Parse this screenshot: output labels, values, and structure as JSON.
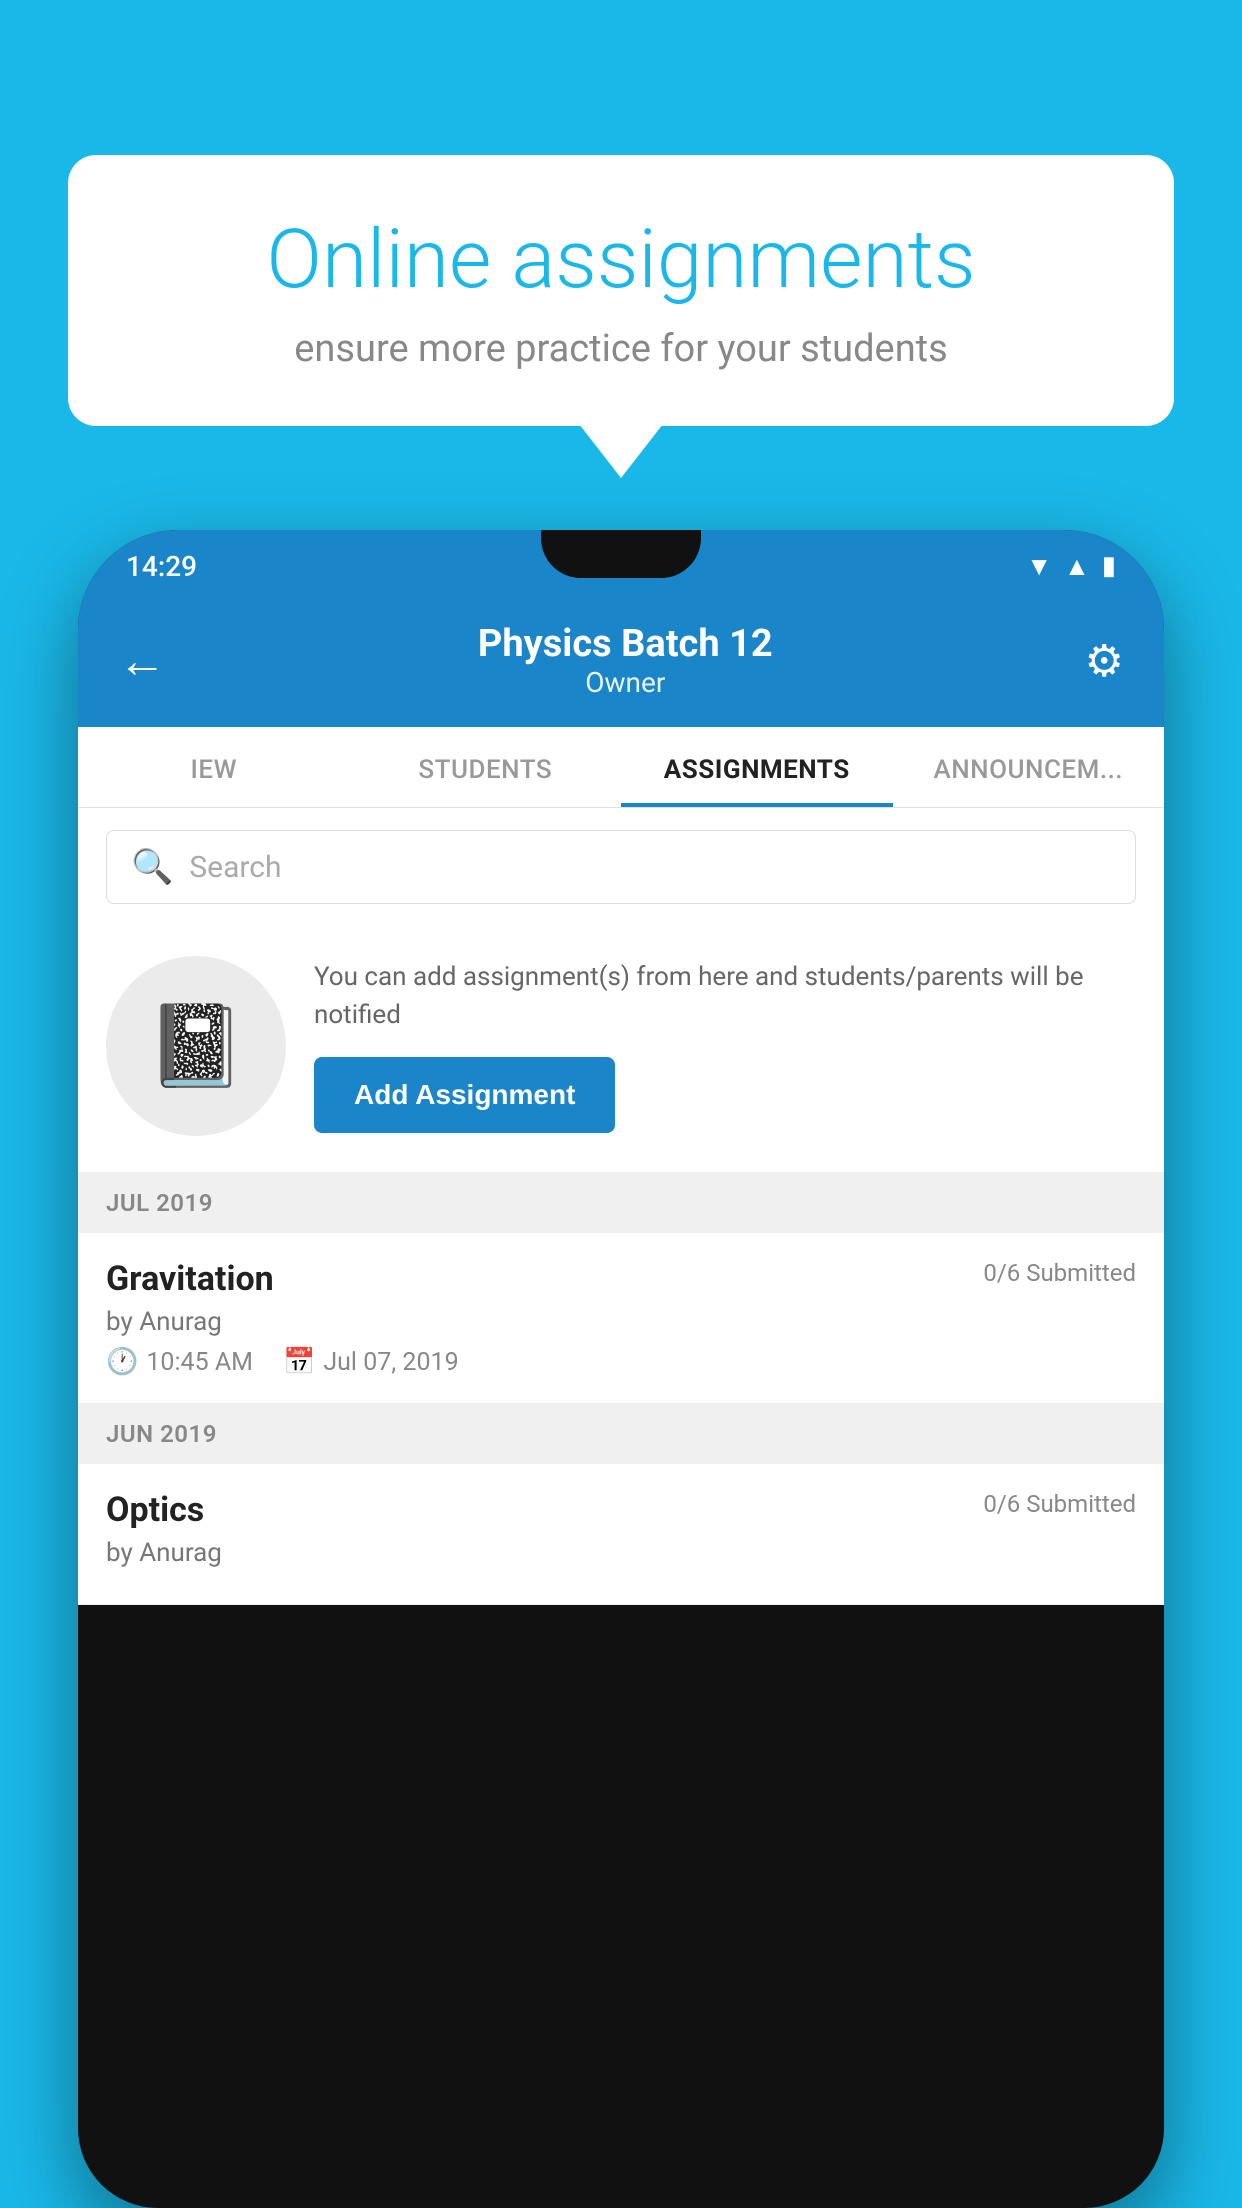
{
  "background_color": "#1ab8e8",
  "speech_bubble": {
    "title": "Online assignments",
    "subtitle": "ensure more practice for your students"
  },
  "status_bar": {
    "time": "14:29",
    "wifi_icon": "▲",
    "signal_icon": "▲",
    "battery_icon": "▮"
  },
  "header": {
    "title": "Physics Batch 12",
    "subtitle": "Owner",
    "back_label": "←",
    "settings_label": "⚙"
  },
  "tabs": [
    {
      "label": "IEW",
      "active": false
    },
    {
      "label": "STUDENTS",
      "active": false
    },
    {
      "label": "ASSIGNMENTS",
      "active": true
    },
    {
      "label": "ANNOUNCEM...",
      "active": false
    }
  ],
  "search": {
    "placeholder": "Search"
  },
  "promo": {
    "description": "You can add assignment(s) from here and students/parents will be notified",
    "button_label": "Add Assignment"
  },
  "month_groups": [
    {
      "month": "JUL 2019",
      "assignments": [
        {
          "title": "Gravitation",
          "submitted": "0/6 Submitted",
          "author": "by Anurag",
          "time": "10:45 AM",
          "date": "Jul 07, 2019"
        }
      ]
    },
    {
      "month": "JUN 2019",
      "assignments": [
        {
          "title": "Optics",
          "submitted": "0/6 Submitted",
          "author": "by Anurag",
          "time": "",
          "date": ""
        }
      ]
    }
  ]
}
